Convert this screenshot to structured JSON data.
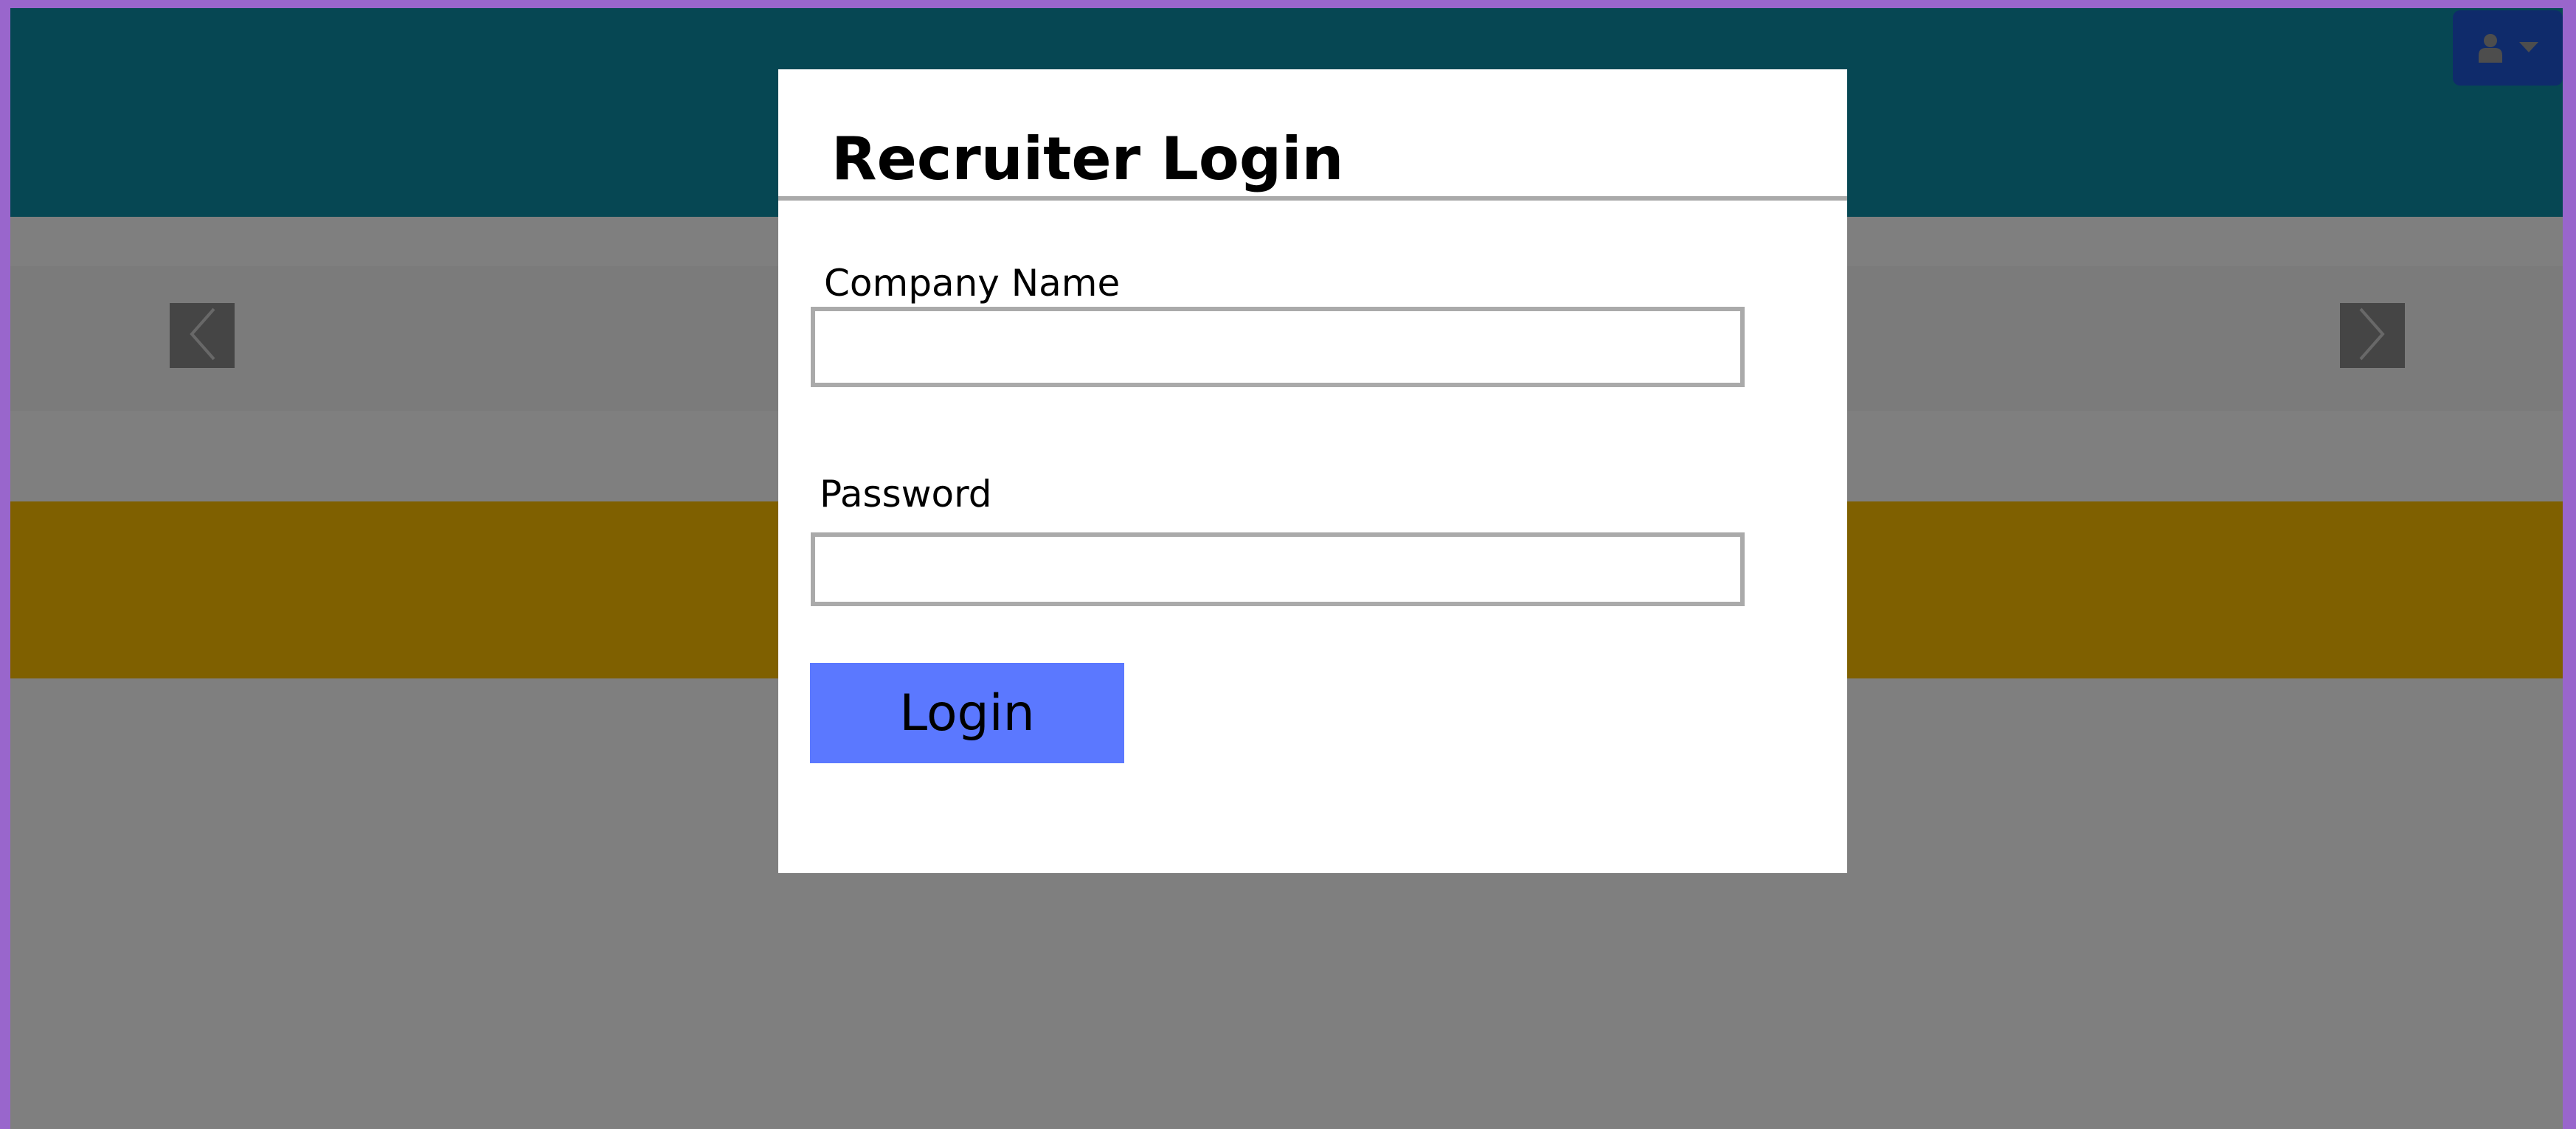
{
  "colors": {
    "border": "#9966cc",
    "header": "#0c8fa6",
    "user_menu": "#1f57d6",
    "banner": "#ffc000",
    "login_button": "#5b78ff",
    "overlay": "rgba(0,0,0,0.5)"
  },
  "header": {
    "user_menu": {
      "icons": [
        "user-icon",
        "caret-down-icon"
      ]
    }
  },
  "carousel": {
    "icons": [
      "chevron-left-icon",
      "chevron-right-icon"
    ]
  },
  "modal": {
    "title": "Recruiter Login",
    "company_label": "Company Name",
    "company_value": "",
    "password_label": "Password",
    "password_value": "",
    "login_label": "Login"
  }
}
